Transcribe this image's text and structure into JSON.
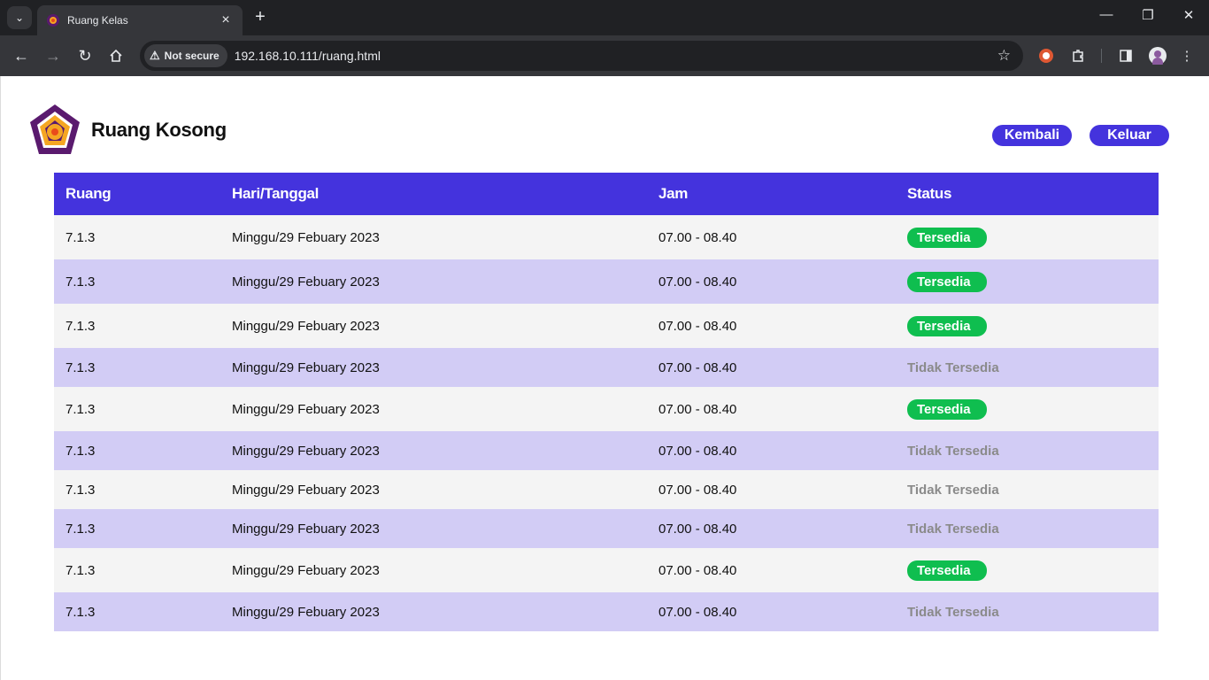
{
  "browser": {
    "tab_title": "Ruang Kelas",
    "secure_label": "Not secure",
    "url": "192.168.10.111/ruang.html"
  },
  "header": {
    "title": "Ruang Kosong",
    "back_label": "Kembali",
    "logout_label": "Keluar"
  },
  "table": {
    "headers": [
      "Ruang",
      "Hari/Tanggal",
      "Jam",
      "Status"
    ],
    "rows": [
      {
        "ruang": "7.1.3",
        "tanggal": "Minggu/29 Febuary 2023",
        "jam": "07.00 - 08.40",
        "status": "Tersedia",
        "available": true
      },
      {
        "ruang": "7.1.3",
        "tanggal": "Minggu/29 Febuary 2023",
        "jam": "07.00 - 08.40",
        "status": "Tersedia",
        "available": true
      },
      {
        "ruang": "7.1.3",
        "tanggal": "Minggu/29 Febuary 2023",
        "jam": "07.00 - 08.40",
        "status": "Tersedia",
        "available": true
      },
      {
        "ruang": "7.1.3",
        "tanggal": "Minggu/29 Febuary 2023",
        "jam": "07.00 - 08.40",
        "status": "Tidak Tersedia",
        "available": false
      },
      {
        "ruang": "7.1.3",
        "tanggal": "Minggu/29 Febuary 2023",
        "jam": "07.00 - 08.40",
        "status": "Tersedia",
        "available": true
      },
      {
        "ruang": "7.1.3",
        "tanggal": "Minggu/29 Febuary 2023",
        "jam": "07.00 - 08.40",
        "status": "Tidak Tersedia",
        "available": false
      },
      {
        "ruang": "7.1.3",
        "tanggal": "Minggu/29 Febuary 2023",
        "jam": "07.00 - 08.40",
        "status": "Tidak Tersedia",
        "available": false
      },
      {
        "ruang": "7.1.3",
        "tanggal": "Minggu/29 Febuary 2023",
        "jam": "07.00 - 08.40",
        "status": "Tidak Tersedia",
        "available": false
      },
      {
        "ruang": "7.1.3",
        "tanggal": "Minggu/29 Febuary 2023",
        "jam": "07.00 - 08.40",
        "status": "Tersedia",
        "available": true
      },
      {
        "ruang": "7.1.3",
        "tanggal": "Minggu/29 Febuary 2023",
        "jam": "07.00 - 08.40",
        "status": "Tidak Tersedia",
        "available": false
      }
    ]
  },
  "colors": {
    "accent": "#4433dd",
    "row_alt": "#d2ccf5",
    "row_base": "#f4f4f4",
    "available": "#0fbe4f",
    "unavailable_text": "#8a8a8a"
  }
}
